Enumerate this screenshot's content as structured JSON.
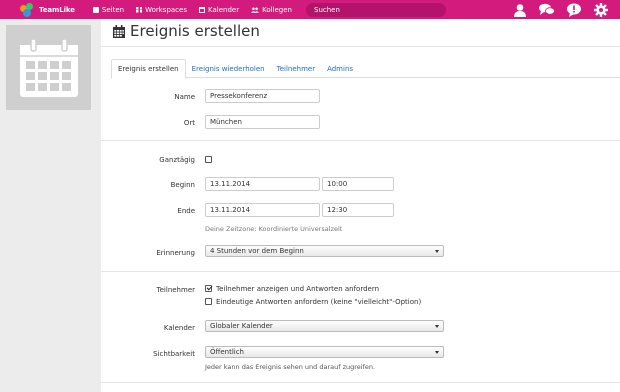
{
  "app": {
    "name": "TeamLike"
  },
  "nav": {
    "items": [
      {
        "label": "Seiten",
        "icon": "pages-icon"
      },
      {
        "label": "Workspaces",
        "icon": "workspaces-icon"
      },
      {
        "label": "Kalender",
        "icon": "calendar-icon"
      },
      {
        "label": "Kollegen",
        "icon": "users-icon"
      }
    ],
    "search_placeholder": "Suchen"
  },
  "topbar_icons": [
    "profile-icon",
    "chat-icon",
    "notifications-icon",
    "settings-icon"
  ],
  "colors": {
    "brand": "#d31b7e",
    "link": "#1f6fb5"
  },
  "page": {
    "title": "Ereignis erstellen"
  },
  "tabs": [
    {
      "label": "Ereignis erstellen",
      "active": true
    },
    {
      "label": "Ereignis wiederholen",
      "active": false
    },
    {
      "label": "Teilnehmer",
      "active": false
    },
    {
      "label": "Admins",
      "active": false
    }
  ],
  "form": {
    "name": {
      "label": "Name",
      "value": "Pressekonferenz"
    },
    "ort": {
      "label": "Ort",
      "value": "München"
    },
    "ganztaegig": {
      "label": "Ganztägig",
      "checked": false
    },
    "beginn": {
      "label": "Beginn",
      "date": "13.11.2014",
      "time": "10:00"
    },
    "ende": {
      "label": "Ende",
      "date": "13.11.2014",
      "time": "12:30"
    },
    "timezone_hint": "Deine Zeitzone: Koordinierte Universalzeit",
    "erinnerung": {
      "label": "Erinnerung",
      "value": "4 Stunden vor dem Beginn"
    },
    "teilnehmer": {
      "label": "Teilnehmer",
      "option1": {
        "label": "Teilnehmer anzeigen und Antworten anfordern",
        "checked": true
      },
      "option2": {
        "label": "Eindeutige Antworten anfordern (keine \"vielleicht\"-Option)",
        "checked": false
      }
    },
    "kalender": {
      "label": "Kalender",
      "value": "Globaler Kalender"
    },
    "sichtbarkeit": {
      "label": "Sichtbarkeit",
      "value": "Öffentlich",
      "hint": "Jeder kann das Ereignis sehen und darauf zugreifen."
    }
  }
}
